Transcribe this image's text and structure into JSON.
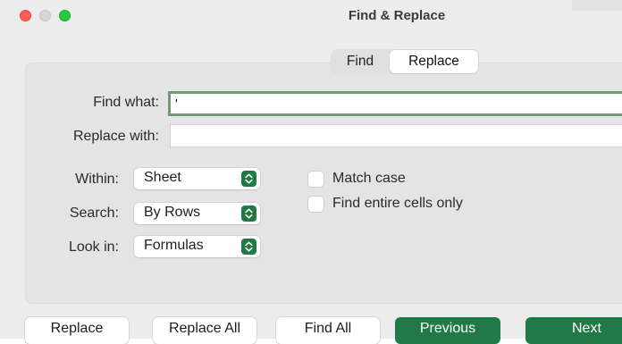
{
  "window": {
    "title": "Find & Replace",
    "traffic_lights": [
      "close",
      "minimize",
      "zoom"
    ]
  },
  "tabs": {
    "items": [
      "Find",
      "Replace"
    ],
    "selected": "Replace"
  },
  "form": {
    "find_label": "Find what:",
    "find_value": "'",
    "replace_label": "Replace with:",
    "replace_value": ""
  },
  "options": {
    "within_label": "Within:",
    "within_value": "Sheet",
    "search_label": "Search:",
    "search_value": "By Rows",
    "lookin_label": "Look in:",
    "lookin_value": "Formulas",
    "popup_icon": "up-down-chevron-icon"
  },
  "checks": {
    "match_case_label": "Match case",
    "match_case_checked": false,
    "entire_cells_label": "Find entire cells only",
    "entire_cells_checked": false
  },
  "buttons": {
    "replace": "Replace",
    "replace_all": "Replace All",
    "find_all": "Find All",
    "previous": "Previous",
    "next": "Next"
  },
  "colors": {
    "accent_green": "#1f7a45",
    "focus_ring": "#6f9a78",
    "close": "#ff5f57",
    "zoom": "#28c840"
  }
}
